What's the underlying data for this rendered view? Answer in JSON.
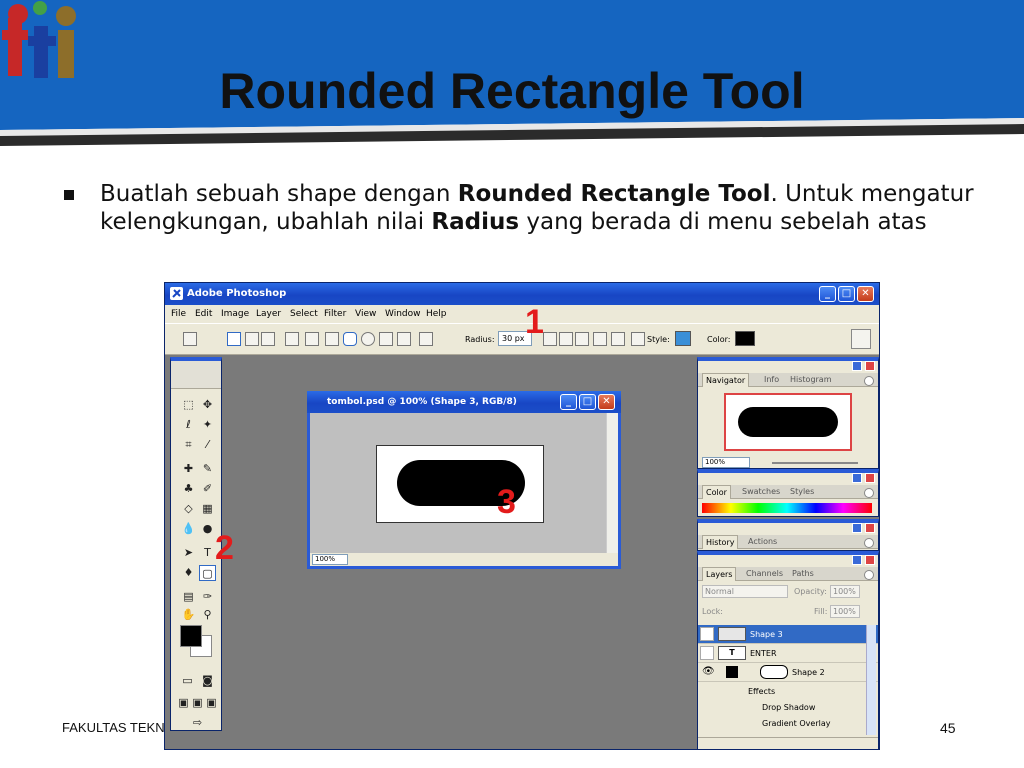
{
  "slide": {
    "title": "Rounded Rectangle Tool",
    "bullet": {
      "part1": "Buatlah sebuah shape dengan ",
      "bold1": "Rounded Rectangle Tool",
      "part2": ". Untuk mengatur kelengkungan, ubahlah nilai ",
      "bold2": "Radius",
      "part3": " yang berada di menu sebelah atas"
    },
    "footer_left": "FAKULTAS TEKN",
    "page_number": "45",
    "colors": {
      "header_blue": "#1565c0",
      "header_stripe": "#2b2b2b",
      "annotation_red": "#e31b1b"
    }
  },
  "photoshop": {
    "title": "Adobe Photoshop",
    "menu": [
      "File",
      "Edit",
      "Image",
      "Layer",
      "Select",
      "Filter",
      "View",
      "Window",
      "Help"
    ],
    "options": {
      "radius_label": "Radius:",
      "radius_value": "30 px",
      "style_label": "Style:",
      "color_label": "Color:"
    },
    "annotations": {
      "one": "1",
      "two": "2",
      "three": "3"
    },
    "document": {
      "title": "tombol.psd @ 100% (Shape 3, RGB/8)",
      "zoom": "100%"
    },
    "navigator": {
      "tabs": [
        "Navigator",
        "Info",
        "Histogram"
      ],
      "zoom": "100%"
    },
    "color_palette": {
      "tabs": [
        "Color",
        "Swatches",
        "Styles"
      ]
    },
    "history_palette": {
      "tabs": [
        "History",
        "Actions"
      ]
    },
    "layers": {
      "tabs": [
        "Layers",
        "Channels",
        "Paths"
      ],
      "blend_mode": "Normal",
      "opacity_label": "Opacity:",
      "opacity_value": "100%",
      "lock_label": "Lock:",
      "fill_label": "Fill:",
      "fill_value": "100%",
      "rows": [
        {
          "name": "Shape 3",
          "selected": true
        },
        {
          "name": "ENTER",
          "thumb": "T"
        },
        {
          "name": "Shape 2"
        }
      ],
      "effects_label": "Effects",
      "effects": [
        "Drop Shadow",
        "Gradient Overlay"
      ]
    }
  }
}
